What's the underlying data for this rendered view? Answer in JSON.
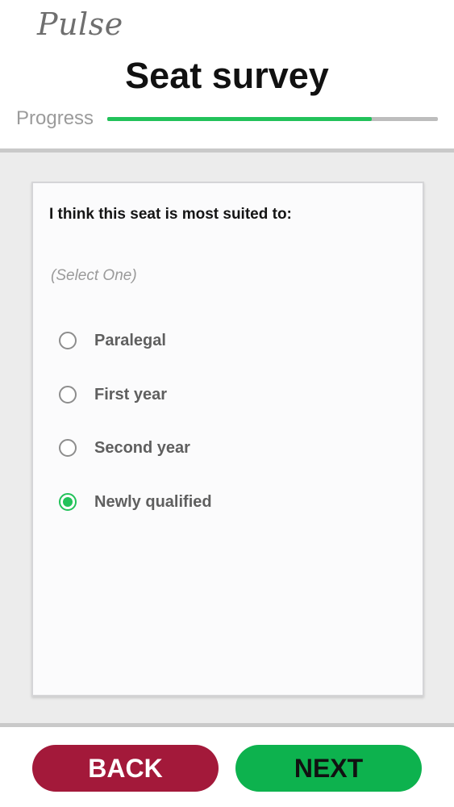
{
  "app": {
    "logo_text": "Pulse",
    "title": "Seat survey"
  },
  "progress": {
    "label": "Progress",
    "value_percent": 80,
    "fill_color": "#22c25a",
    "track_color": "#bdbdbd"
  },
  "question": {
    "text": "I think this seat is most suited to:",
    "hint": "(Select One)",
    "options": [
      {
        "label": "Paralegal",
        "selected": false
      },
      {
        "label": "First year",
        "selected": false
      },
      {
        "label": "Second year",
        "selected": false
      },
      {
        "label": "Newly qualified",
        "selected": true
      }
    ]
  },
  "footer": {
    "back_label": "BACK",
    "next_label": "NEXT",
    "back_color": "#a3193a",
    "next_color": "#0db24e"
  }
}
